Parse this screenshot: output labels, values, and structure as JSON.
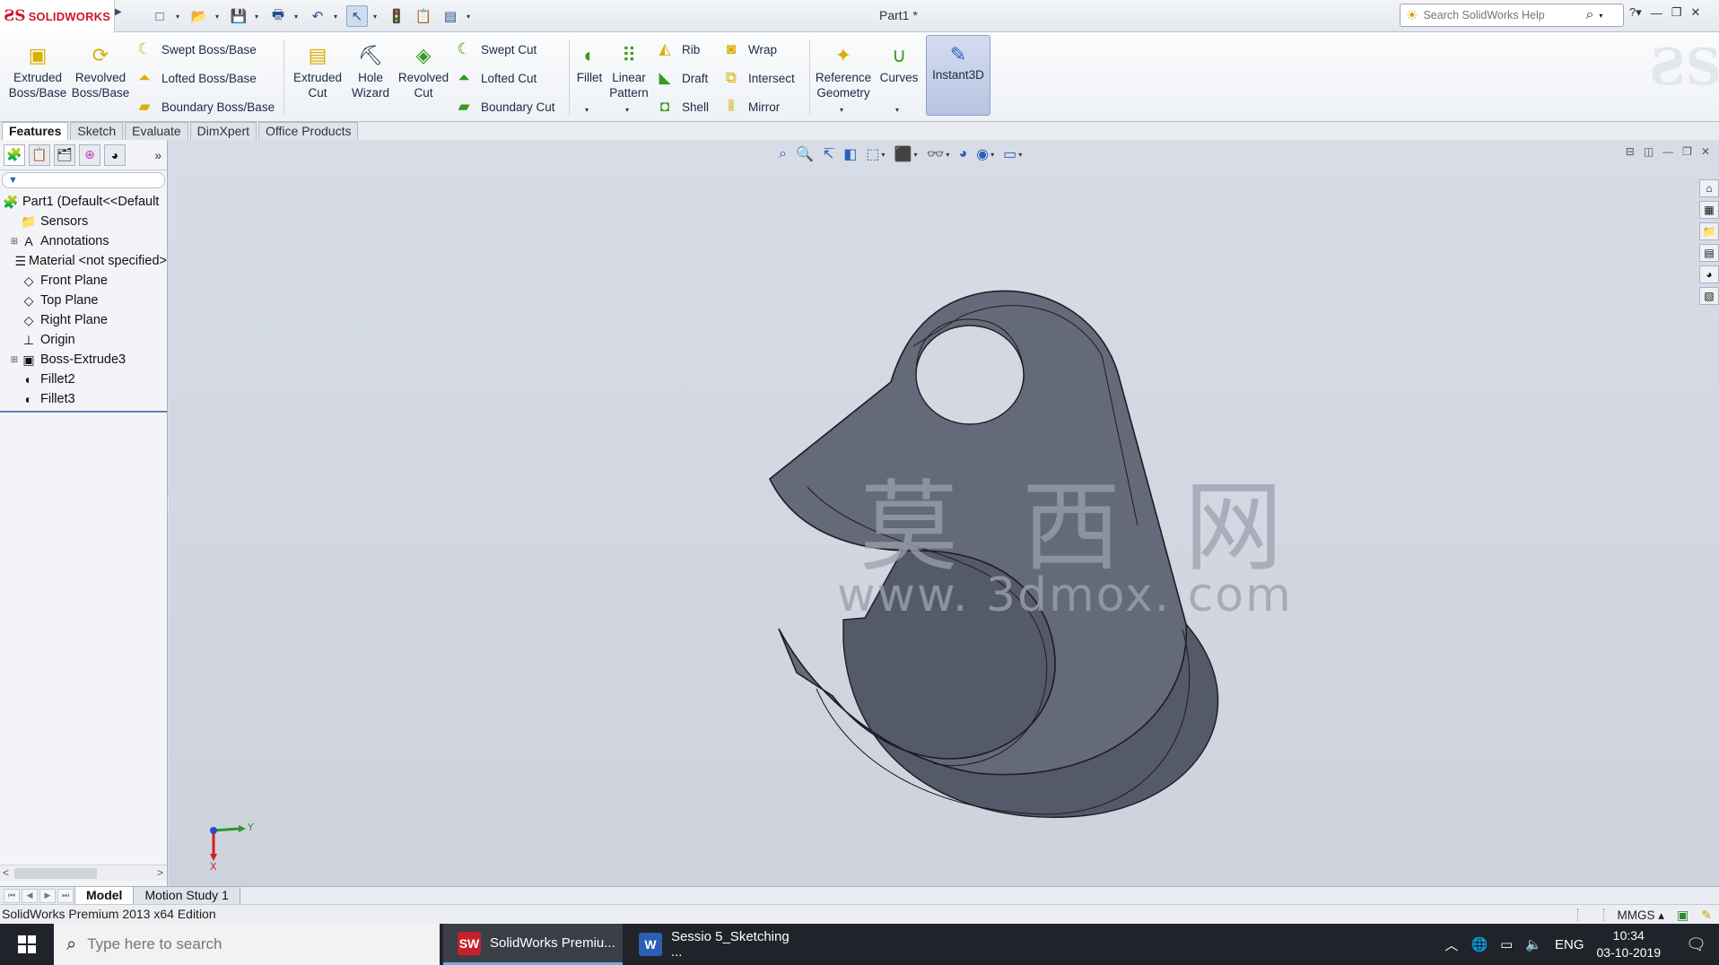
{
  "app": {
    "logo_ds": "ƧS",
    "logo_name": "SOLIDWORKS",
    "document_title": "Part1 *",
    "help_search_placeholder": "Search SolidWorks Help"
  },
  "quick_access": [
    {
      "name": "new",
      "icon": "□"
    },
    {
      "name": "open",
      "icon": "📂"
    },
    {
      "name": "save",
      "icon": "💾"
    },
    {
      "name": "print",
      "icon": "🖶"
    },
    {
      "name": "undo",
      "icon": "↶"
    },
    {
      "name": "select",
      "icon": "↖"
    },
    {
      "name": "rebuild",
      "icon": "🚦"
    },
    {
      "name": "file-properties",
      "icon": "📋"
    },
    {
      "name": "options",
      "icon": "▤"
    }
  ],
  "features": {
    "extruded_boss": "Extruded Boss/Base",
    "revolved_boss": "Revolved Boss/Base",
    "swept_boss": "Swept Boss/Base",
    "lofted_boss": "Lofted Boss/Base",
    "boundary_boss": "Boundary Boss/Base",
    "extruded_cut": "Extruded Cut",
    "hole_wizard": "Hole Wizard",
    "revolved_cut": "Revolved Cut",
    "swept_cut": "Swept Cut",
    "lofted_cut": "Lofted Cut",
    "boundary_cut": "Boundary Cut",
    "fillet": "Fillet",
    "linear_pattern": "Linear Pattern",
    "rib": "Rib",
    "draft": "Draft",
    "shell": "Shell",
    "wrap": "Wrap",
    "intersect": "Intersect",
    "mirror": "Mirror",
    "reference_geometry": "Reference Geometry",
    "curves": "Curves",
    "instant3d": "Instant3D"
  },
  "cm_tabs": [
    "Features",
    "Sketch",
    "Evaluate",
    "DimXpert",
    "Office Products"
  ],
  "tree": [
    {
      "label": "Part1  (Default<<Default",
      "icon": "🧩",
      "expander": "",
      "type": "root"
    },
    {
      "label": "Sensors",
      "icon": "📁",
      "expander": "",
      "type": "child"
    },
    {
      "label": "Annotations",
      "icon": "A",
      "expander": "⊞",
      "type": "child"
    },
    {
      "label": "Material <not specified>",
      "icon": "☰",
      "expander": "",
      "type": "child"
    },
    {
      "label": "Front Plane",
      "icon": "◇",
      "expander": "",
      "type": "child"
    },
    {
      "label": "Top Plane",
      "icon": "◇",
      "expander": "",
      "type": "child"
    },
    {
      "label": "Right Plane",
      "icon": "◇",
      "expander": "",
      "type": "child"
    },
    {
      "label": "Origin",
      "icon": "⊥",
      "expander": "",
      "type": "child"
    },
    {
      "label": "Boss-Extrude3",
      "icon": "▣",
      "expander": "⊞",
      "type": "child"
    },
    {
      "label": "Fillet2",
      "icon": "◐",
      "expander": "",
      "type": "child"
    },
    {
      "label": "Fillet3",
      "icon": "◐",
      "expander": "",
      "type": "child"
    }
  ],
  "watermark": {
    "cn": "莫 西 网",
    "url": "www. 3dmox. com"
  },
  "triad": {
    "x_label": "X",
    "y_label": "Y"
  },
  "model_tabs": [
    "Model",
    "Motion Study 1"
  ],
  "status": {
    "edition": "SolidWorks Premium 2013 x64 Edition",
    "units": "MMGS",
    "units_arrow": "▴"
  },
  "taskbar": {
    "search_placeholder": "Type here to search",
    "apps": [
      {
        "label": "SolidWorks Premiu...",
        "badge": "SW",
        "color": "#c8202a"
      },
      {
        "label": "Sessio 5_Sketching ...",
        "badge": "W",
        "color": "#2b5fb4"
      }
    ],
    "lang": "ENG",
    "time": "10:34",
    "date": "03-10-2019"
  },
  "colors": {
    "model_face": "#555a6a",
    "model_top": "#656a7a",
    "model_edge": "#1c1d22",
    "accent": "#2f5fb8"
  }
}
